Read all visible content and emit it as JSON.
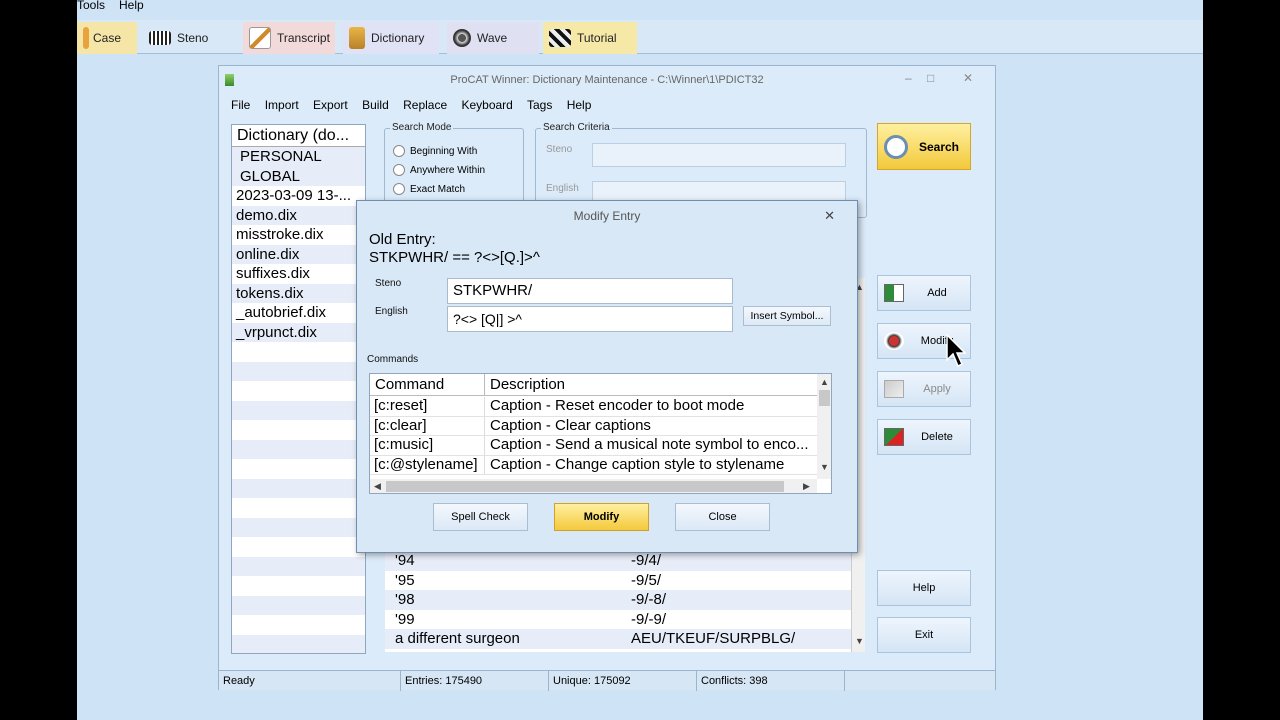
{
  "app_menu": {
    "tools": "Tools",
    "help": "Help"
  },
  "ribbon": {
    "tabs": [
      {
        "label": "Case",
        "icon": "case-icon"
      },
      {
        "label": "Steno",
        "icon": "keyboard-icon"
      },
      {
        "label": "Transcript",
        "icon": "pen-icon"
      },
      {
        "label": "Dictionary",
        "icon": "book-icon"
      },
      {
        "label": "Wave",
        "icon": "wave-icon"
      },
      {
        "label": "Tutorial",
        "icon": "clapper-icon"
      }
    ]
  },
  "main_window": {
    "title": "ProCAT Winner: Dictionary Maintenance - C:\\Winner\\1\\PDICT32",
    "minimize": "–",
    "maximize": "□",
    "close": "✕",
    "menu": [
      "File",
      "Import",
      "Export",
      "Build",
      "Replace",
      "Keyboard",
      "Tags",
      "Help"
    ]
  },
  "dictionaries": {
    "header": "Dictionary (do...",
    "items": [
      "PERSONAL",
      "GLOBAL",
      "2023-03-09 13-...",
      "demo.dix",
      "misstroke.dix",
      "online.dix",
      "suffixes.dix",
      "tokens.dix",
      "_autobrief.dix",
      "_vrpunct.dix"
    ]
  },
  "search_mode": {
    "label": "Search Mode",
    "options": [
      "Beginning With",
      "Anywhere Within",
      "Exact Match"
    ]
  },
  "search_criteria": {
    "label": "Search Criteria",
    "steno_label": "Steno",
    "english_label": "English"
  },
  "results": {
    "rows": [
      {
        "english": "'94",
        "steno": "-9/4/"
      },
      {
        "english": "'95",
        "steno": "-9/5/"
      },
      {
        "english": "'98",
        "steno": "-9/-8/"
      },
      {
        "english": "'99",
        "steno": "-9/-9/"
      },
      {
        "english": "a different surgeon",
        "steno": "AEU/TKEUF/SURPBLG/"
      }
    ]
  },
  "side_buttons": {
    "search": "Search",
    "add": "Add",
    "modify": "Modify",
    "apply": "Apply",
    "delete": "Delete",
    "help": "Help",
    "exit": "Exit"
  },
  "status_bar": {
    "state": "Ready",
    "entries": "Entries: 175490",
    "unique": "Unique: 175092",
    "conflicts": "Conflicts: 398"
  },
  "modal": {
    "title": "Modify Entry",
    "close": "✕",
    "old_entry_label": "Old Entry:",
    "old_entry_value": "STKPWHR/ == ?<>[Q.]>^",
    "steno_label": "Steno",
    "steno_value": "STKPWHR/",
    "english_label": "English",
    "english_value": "?<> [Q|] >^",
    "insert_symbol": "Insert Symbol...",
    "commands_label": "Commands",
    "columns": [
      "Command",
      "Description"
    ],
    "commands": [
      {
        "command": "[c:reset]",
        "description": "Caption - Reset encoder to boot mode"
      },
      {
        "command": "[c:clear]",
        "description": "Caption - Clear captions"
      },
      {
        "command": "[c:music]",
        "description": "Caption - Send a musical note symbol to enco..."
      },
      {
        "command": "[c:@stylename]",
        "description": "Caption - Change caption style to stylename"
      }
    ],
    "buttons": {
      "spell_check": "Spell Check",
      "modify": "Modify",
      "close": "Close"
    }
  }
}
